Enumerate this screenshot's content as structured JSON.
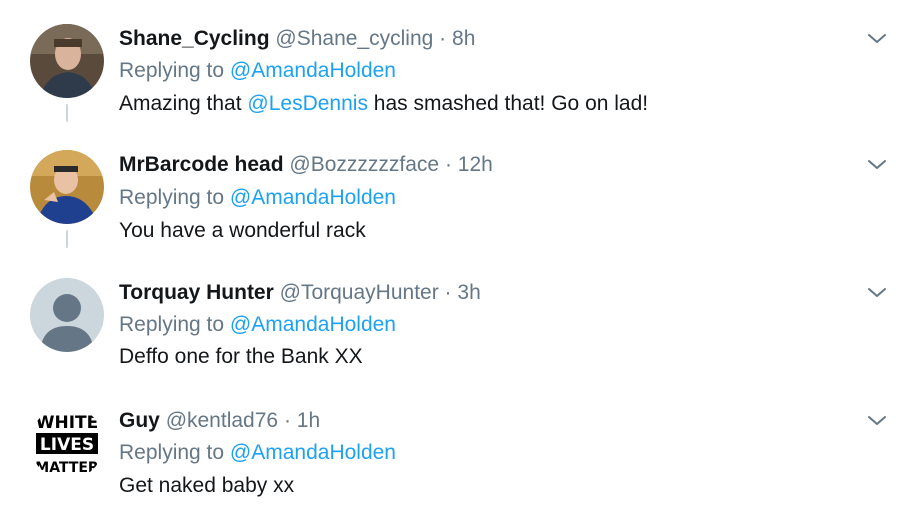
{
  "colors": {
    "link": "#1da1f2",
    "muted": "#657786",
    "text": "#14171a",
    "thread_line": "#ccd6dd"
  },
  "replying_prefix": "Replying to",
  "tweets": [
    {
      "name": "Shane_Cycling",
      "handle": "@Shane_cycling",
      "separator": "·",
      "time": "8h",
      "replying_to": "@AmandaHolden",
      "text_before": "Amazing that ",
      "mention": "@LesDennis",
      "text_after": " has smashed that! Go on lad!",
      "avatar_icon": "user-photo-avatar",
      "menu_icon": "chevron-down-icon"
    },
    {
      "name": "MrBarcode head",
      "handle": "@Bozzzzzzface",
      "separator": "·",
      "time": "12h",
      "replying_to": "@AmandaHolden",
      "text": "You have a wonderful rack",
      "avatar_icon": "user-photo-avatar",
      "menu_icon": "chevron-down-icon"
    },
    {
      "name": "Torquay Hunter",
      "handle": "@TorquayHunter",
      "separator": "·",
      "time": "3h",
      "replying_to": "@AmandaHolden",
      "text": "Deffo one for the Bank XX",
      "avatar_icon": "default-profile-avatar",
      "menu_icon": "chevron-down-icon"
    },
    {
      "name": "Guy",
      "handle": "@kentlad76",
      "separator": "·",
      "time": "1h",
      "replying_to": "@AmandaHolden",
      "text": "Get naked baby xx",
      "avatar_text": [
        "WHITE",
        "LIVES",
        "MATTER"
      ],
      "avatar_icon": "text-logo-avatar",
      "menu_icon": "chevron-down-icon"
    }
  ]
}
